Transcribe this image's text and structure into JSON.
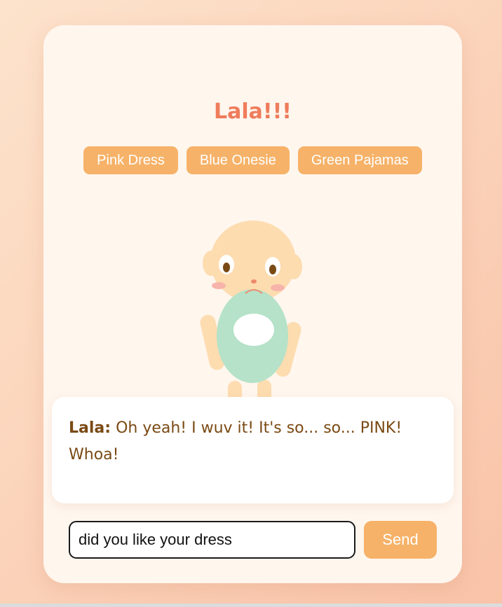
{
  "header": {
    "title": "Lala!!!"
  },
  "outfits": [
    {
      "label": "Pink Dress"
    },
    {
      "label": "Blue Onesie"
    },
    {
      "label": "Green Pajamas"
    }
  ],
  "character": {
    "icon": "baby-character-icon",
    "outfit_color": "#b5e2c8",
    "skin_color": "#fddcb0"
  },
  "speech": {
    "speaker": "Lala:",
    "message": "Oh yeah! I wuv it! It's so... so... PINK! Whoa!"
  },
  "composer": {
    "input_value": "did you like your dress",
    "send_label": "Send"
  },
  "colors": {
    "accent": "#f6b268",
    "title": "#ef7c5b",
    "speech_text": "#7a4a14",
    "card_bg": "#fff6ee"
  }
}
